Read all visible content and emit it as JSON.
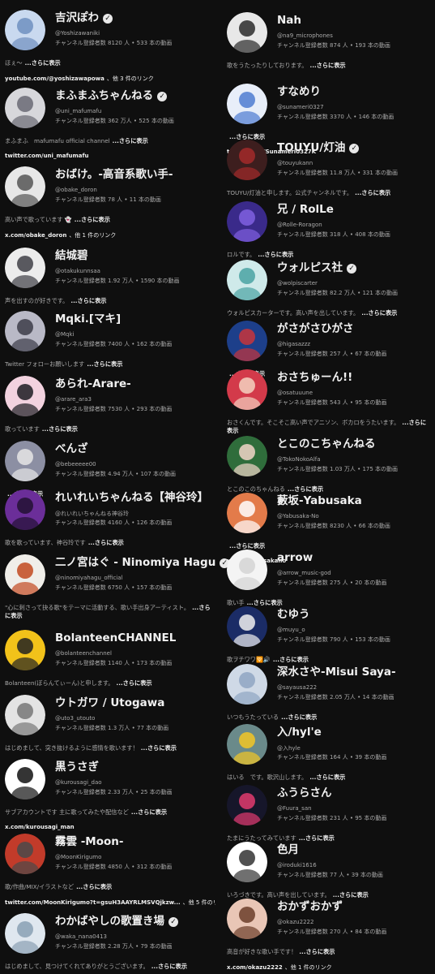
{
  "common": {
    "subs_label": "チャンネル登録者数",
    "videos_suffix": "本の動画",
    "more": "...さらに表示",
    "verified": "✓"
  },
  "left": [
    {
      "name": "吉沢ぽわ",
      "verified": true,
      "handle": "@Yoshizawaniki",
      "subs": "8120 人",
      "videos": "533",
      "desc": "ほぇ～",
      "link": "youtube.com/@yoshizawapowa",
      "link_extra": "、他 3 件のリンク",
      "avatar": "moon-avatar"
    },
    {
      "name": "まふまふちゃんねる",
      "verified": true,
      "handle": "@uni_mafumafu",
      "subs": "362 万人",
      "videos": "525",
      "desc": "まふまふ　mafumafu official channel",
      "link": "twitter.com/uni_mafumafu",
      "link_extra": "",
      "avatar": "white-hair-avatar"
    },
    {
      "name": "おばけ。-高音系歌い手-",
      "verified": false,
      "handle": "@obake_doron",
      "subs": "78 人",
      "videos": "11",
      "desc": "高い声で歌っています 👻",
      "link": "x.com/obake_doron",
      "link_extra": "、他 1 件のリンク",
      "avatar": "ghost-avatar"
    },
    {
      "name": "結城碧",
      "verified": false,
      "handle": "@otakukunnsaa",
      "subs": "1.92 万人",
      "videos": "1590",
      "desc": "声を出すのが好きです。",
      "link": "",
      "link_extra": "",
      "avatar": "bird-avatar"
    },
    {
      "name": "Mqki.[マキ]",
      "verified": false,
      "handle": "@Mqki",
      "subs": "7400 人",
      "videos": "162",
      "desc": "Twitter フォローお願いします",
      "link": "",
      "link_extra": "",
      "avatar": "gray-hair-avatar"
    },
    {
      "name": "あられ-Arare-",
      "verified": false,
      "handle": "@arare_ara3",
      "subs": "7530 人",
      "videos": "293",
      "desc": "歌っています",
      "link": "",
      "link_extra": "",
      "avatar": "pink-avatar"
    },
    {
      "name": "べんざ",
      "verified": false,
      "handle": "@bebeeeee00",
      "subs": "4.94 万人",
      "videos": "107",
      "desc": "",
      "link": "",
      "link_extra": "",
      "avatar": "sparrows-avatar"
    },
    {
      "name": "れいれいちゃんねる【神谷玲】",
      "verified": false,
      "handle": "@れいれいちゃんねる神谷玲",
      "subs": "4160 人",
      "videos": "126",
      "desc": "歌を歌っています、神谷玲です",
      "link": "",
      "link_extra": "",
      "avatar": "purple-avatar"
    },
    {
      "name": "二ノ宮はぐ - Ninomiya Hagu",
      "verified": true,
      "handle": "@ninomiyahagu_official",
      "subs": "6750 人",
      "videos": "157",
      "desc": "\"心に刺さって抉る歌\"をテーマに活動する、歌い手出身アーティスト。",
      "link": "",
      "link_extra": "",
      "avatar": "flower-avatar"
    },
    {
      "name": "BolanteenCHANNEL",
      "verified": false,
      "handle": "@bolanteenchannel",
      "subs": "1140 人",
      "videos": "173",
      "desc": "Bolanteen(ぼらんてぃーん)と申します。",
      "link": "",
      "link_extra": "",
      "avatar": "yellow-avatar"
    },
    {
      "name": "ウトガワ / Utogawa",
      "verified": false,
      "handle": "@uto3_utouto",
      "subs": "1.3 万人",
      "videos": "77",
      "desc": "はじめまして、突き抜けるように感情を歌います！",
      "link": "",
      "link_extra": "",
      "avatar": "sketch-avatar"
    },
    {
      "name": "黒うさぎ",
      "verified": false,
      "handle": "@kurousagi_dao",
      "subs": "2.33 万人",
      "videos": "25",
      "desc": "サブアカウントです 主に歌ってみたや配信など",
      "link": "x.com/kurousagi_man",
      "link_extra": "",
      "avatar": "black-hair-avatar"
    },
    {
      "name": "霧雲 -Moon-",
      "verified": false,
      "handle": "@MoonKirigumo",
      "subs": "4850 人",
      "videos": "312",
      "desc": "歌/作曲/MIX/イラストなど",
      "link": "twitter.com/MoonKirigumo?t=gsuH3AAYRLMSVQjkzw...",
      "link_extra": "、他 5 件のリンク",
      "avatar": "red-hat-avatar"
    },
    {
      "name": "わかばやしの歌置き場",
      "verified": true,
      "handle": "@waka_nana0413",
      "subs": "2.28 万人",
      "videos": "79",
      "desc": "はじめまして、見つけてくれてありがとうございます。",
      "link": "",
      "link_extra": "",
      "avatar": "green-hair-avatar"
    }
  ],
  "right": [
    {
      "name": "Nah",
      "verified": false,
      "handle": "@na9_microphones",
      "subs": "874 人",
      "videos": "193",
      "desc": "歌をうたったりしております。",
      "link": "",
      "link_extra": "",
      "avatar": "dark-boy-avatar"
    },
    {
      "name": "すなめり",
      "verified": false,
      "handle": "@sunameri0327",
      "subs": "3370 人",
      "videos": "146",
      "desc": "",
      "link": "twitter.com/Sunameri0327K",
      "link_extra": "",
      "avatar": "blue-sketch-avatar"
    },
    {
      "name": "TOUYU/灯油",
      "verified": true,
      "handle": "@touyukann",
      "subs": "11.8 万人",
      "videos": "331",
      "desc": "TOUYU/灯油と申します。公式チャンネルです。",
      "link": "",
      "link_extra": "",
      "avatar": "red-dark-avatar"
    },
    {
      "name": "兄 / RolLe",
      "verified": false,
      "handle": "@Rolle-Roragon",
      "subs": "318 人",
      "videos": "408",
      "desc": "ロルです。",
      "link": "",
      "link_extra": "",
      "avatar": "violet-avatar"
    },
    {
      "name": "ウォルピス社",
      "verified": true,
      "handle": "@wolpiscarter",
      "subs": "82.2 万人",
      "videos": "121",
      "desc": "ウォルピスカーターです。高い声を出しています。",
      "link": "",
      "link_extra": "",
      "avatar": "milk-carton-avatar"
    },
    {
      "name": "がさがさひがさ",
      "verified": false,
      "handle": "@higasazzz",
      "subs": "257 人",
      "videos": "67",
      "desc": "",
      "link": "",
      "link_extra": "",
      "avatar": "blue-red-avatar"
    },
    {
      "name": "おさちゅーん!!",
      "verified": false,
      "handle": "@osatuuune",
      "subs": "543 人",
      "videos": "95",
      "desc": "おさくんです。そこそこ高い声でアニソン、ボカロをうたいます。",
      "link": "",
      "link_extra": "",
      "avatar": "redhead-avatar"
    },
    {
      "name": "とこのこちゃんねる",
      "verified": false,
      "handle": "@TokoNokoAlfa",
      "subs": "1.03 万人",
      "videos": "175",
      "desc": "とこのこのちゃんねる",
      "link": "",
      "link_extra": "",
      "avatar": "green-avatar"
    },
    {
      "name": "藪坂-Yabusaka",
      "verified": false,
      "handle": "@Yabusaka-No",
      "subs": "8230 人",
      "videos": "66",
      "desc": "",
      "link": "x.com/Yabusakano",
      "link_extra": "",
      "avatar": "orange-rabbit-avatar"
    },
    {
      "name": "arrow",
      "verified": false,
      "handle": "@arrow_music-god",
      "subs": "275 人",
      "videos": "20",
      "desc": "歌い手",
      "link": "",
      "link_extra": "",
      "avatar": "white-boy-avatar"
    },
    {
      "name": "むゆう",
      "verified": false,
      "handle": "@muyu_o",
      "subs": "790 人",
      "videos": "153",
      "desc": "歌ヲチワワ🛜🔊",
      "link": "",
      "link_extra": "",
      "avatar": "blue-boy-avatar"
    },
    {
      "name": "深水さや-Misui Saya-",
      "verified": false,
      "handle": "@sayausa222",
      "subs": "2.05 万人",
      "videos": "14",
      "desc": "いつもうたっている",
      "link": "",
      "link_extra": "",
      "avatar": "silver-avatar"
    },
    {
      "name": "入/hyl'e",
      "verified": false,
      "handle": "@入hyle",
      "subs": "164 人",
      "videos": "39",
      "desc": "はいる　です。歌沢山します。",
      "link": "",
      "link_extra": "",
      "avatar": "sunflower-avatar"
    },
    {
      "name": "ふうらさん",
      "verified": false,
      "handle": "@Fuura_san",
      "subs": "231 人",
      "videos": "95",
      "desc": "たまにうたってみています",
      "link": "",
      "link_extra": "",
      "avatar": "pink-black-avatar"
    },
    {
      "name": "色月",
      "verified": false,
      "handle": "@iroduki1616",
      "subs": "77 人",
      "videos": "39",
      "desc": "いろづきです。高い声を出しています。",
      "link": "",
      "link_extra": "",
      "avatar": "doodle-avatar"
    },
    {
      "name": "おかずおかず",
      "verified": false,
      "handle": "@okazu2222",
      "subs": "270 人",
      "videos": "84",
      "desc": "高音が好きな歌い手です！",
      "link": "x.com/okazu2222",
      "link_extra": "、他 1 件のリンク",
      "avatar": "brown-hair-avatar"
    }
  ]
}
